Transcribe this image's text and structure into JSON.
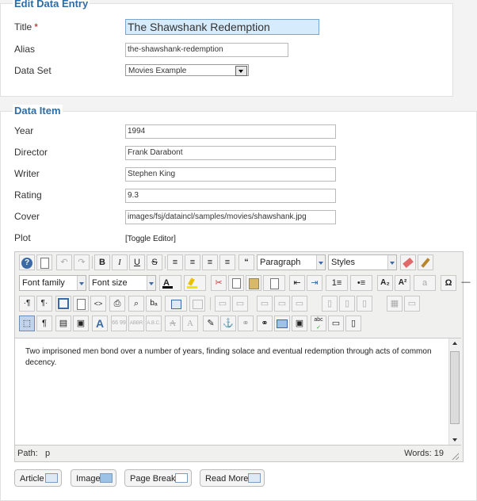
{
  "entry": {
    "legend": "Edit Data Entry",
    "title_label": "Title",
    "required_mark": "*",
    "title_value": "The Shawshank Redemption",
    "alias_label": "Alias",
    "alias_value": "the-shawshank-redemption",
    "dataset_label": "Data Set",
    "dataset_value": "Movies Example"
  },
  "item": {
    "legend": "Data Item",
    "year_label": "Year",
    "year_value": "1994",
    "director_label": "Director",
    "director_value": "Frank Darabont",
    "writer_label": "Writer",
    "writer_value": "Stephen King",
    "rating_label": "Rating",
    "rating_value": "9.3",
    "cover_label": "Cover",
    "cover_value": "images/fsj/dataincl/samples/movies/shawshank.jpg",
    "plot_label": "Plot",
    "toggle_editor": "[Toggle Editor]"
  },
  "editor": {
    "format_select": "Paragraph",
    "styles_select": "Styles",
    "font_family": "Font family",
    "font_size": "Font size",
    "content": "Two imprisoned men bond over a number of years, finding solace and eventual redemption through acts of common decency.",
    "path_label": "Path:",
    "path_value": "p",
    "words": "Words: 19",
    "icons": [
      "help-icon",
      "new-document-icon",
      "undo-icon",
      "redo-icon",
      "bold-icon",
      "italic-icon",
      "underline-icon",
      "strikethrough-icon",
      "align-justify-icon",
      "align-center-icon",
      "align-left-icon",
      "align-right-icon",
      "blockquote-icon",
      "cleanup-icon",
      "brush-icon"
    ],
    "glyphs": {
      "help": "?",
      "bold": "B",
      "italic": "I",
      "underline": "U",
      "strike": "S",
      "quote": "“",
      "cut": "✂",
      "sub": "A₂",
      "sup": "A²",
      "omega": "Ω",
      "ltr": "·¶",
      "rtl": "¶·",
      "pilcrow": "¶",
      "replace": "bₐ",
      "styles_a": "A",
      "abbr": "ABBR",
      "acronym": "A.B.C.",
      "del_a": "A",
      "ins_a": "A",
      "quote_q": "66 99",
      "spell": "abc"
    }
  },
  "buttons": {
    "article": "Article",
    "image": "Image",
    "page_break": "Page Break",
    "read_more": "Read More"
  }
}
